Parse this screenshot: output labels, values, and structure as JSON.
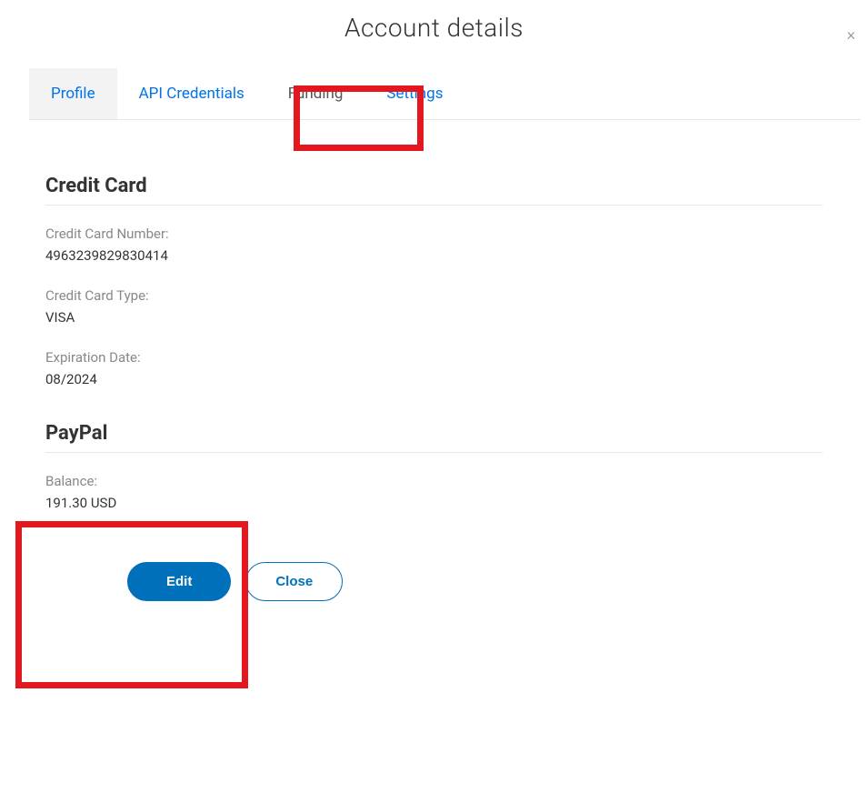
{
  "modal": {
    "title": "Account details",
    "close_icon": "×"
  },
  "tabs": {
    "profile": "Profile",
    "api_credentials": "API Credentials",
    "funding": "Funding",
    "settings": "Settings"
  },
  "credit_card": {
    "heading": "Credit Card",
    "number_label": "Credit Card Number:",
    "number_value": "4963239829830414",
    "type_label": "Credit Card Type:",
    "type_value": "VISA",
    "exp_label": "Expiration Date:",
    "exp_value": "08/2024"
  },
  "paypal": {
    "heading": "PayPal",
    "balance_label": "Balance:",
    "balance_value": "191.30 USD"
  },
  "buttons": {
    "edit": "Edit",
    "close": "Close"
  }
}
